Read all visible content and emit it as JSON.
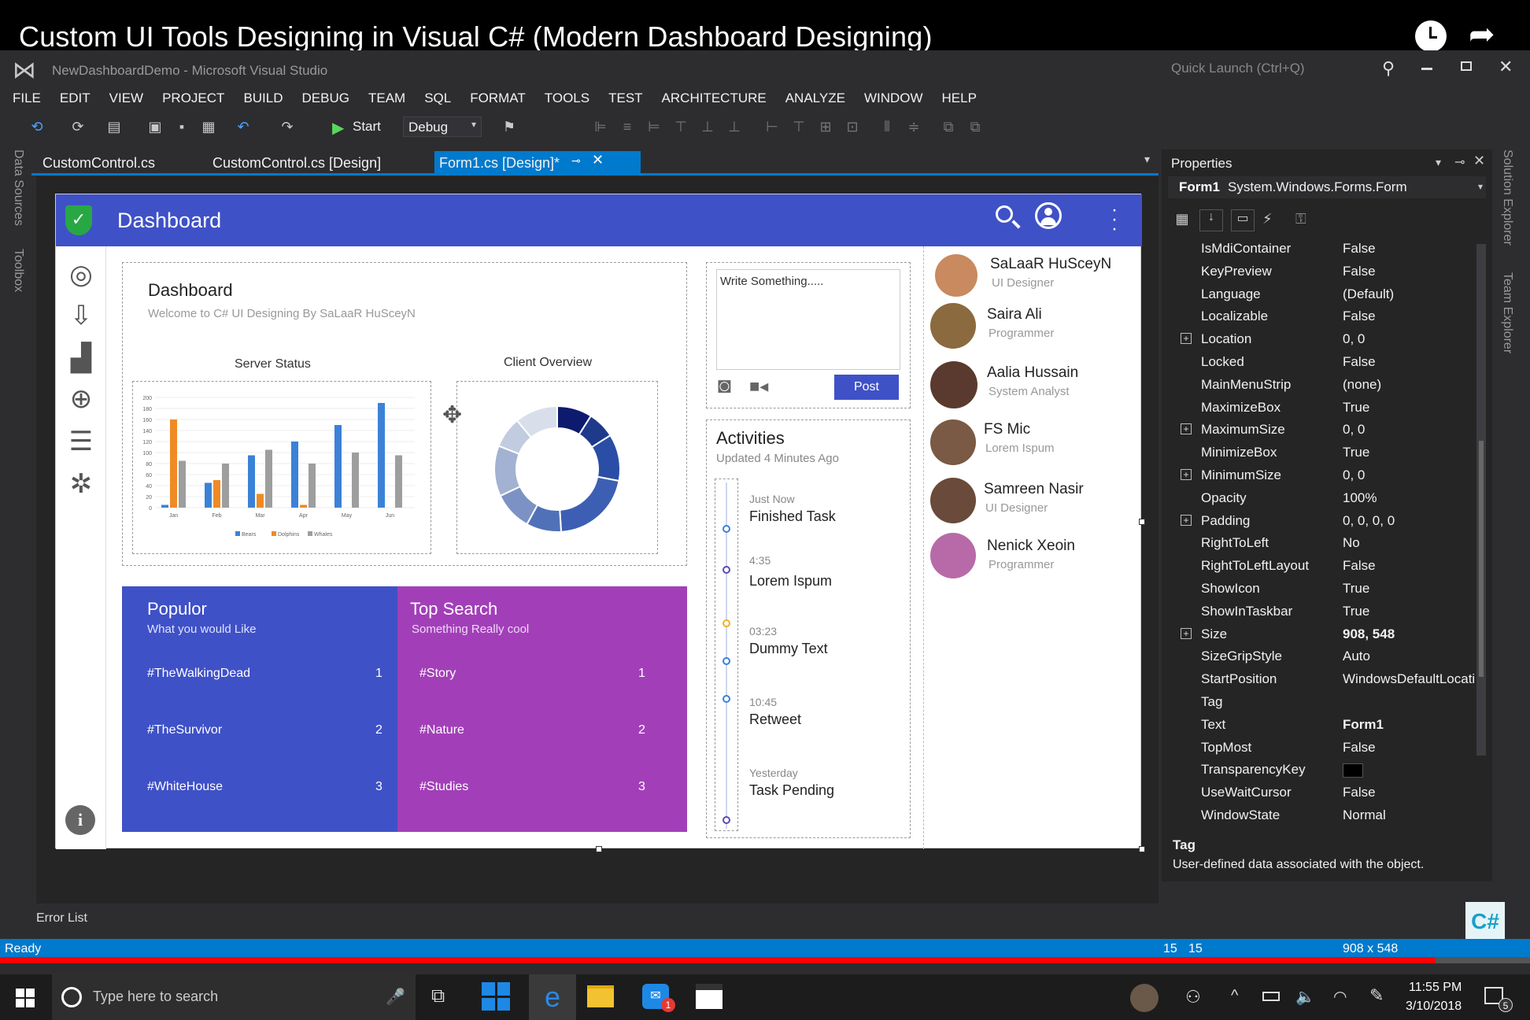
{
  "video_title": "Custom UI Tools Designing in Visual C# (Modern Dashboard Designing)",
  "vs": {
    "window_title": "NewDashboardDemo - Microsoft Visual Studio",
    "quick_launch": "Quick Launch (Ctrl+Q)"
  },
  "menu": [
    "FILE",
    "EDIT",
    "VIEW",
    "PROJECT",
    "BUILD",
    "DEBUG",
    "TEAM",
    "SQL",
    "FORMAT",
    "TOOLS",
    "TEST",
    "ARCHITECTURE",
    "ANALYZE",
    "WINDOW",
    "HELP"
  ],
  "toolbar": {
    "start": "Start",
    "config": "Debug"
  },
  "side_tabs": {
    "data_sources": "Data Sources",
    "toolbox": "Toolbox",
    "solution_explorer": "Solution Explorer",
    "team_explorer": "Team Explorer"
  },
  "tabs": [
    "CustomControl.cs",
    "CustomControl.cs [Design]",
    "Form1.cs [Design]*"
  ],
  "form": {
    "header_title": "Dashboard",
    "main": {
      "title": "Dashboard",
      "subtitle": "Welcome to C# UI Designing By SaLaaR HuSceyN"
    },
    "server_status": "Server Status",
    "client_overview": "Client Overview",
    "post": {
      "placeholder": "Write Something.....",
      "button": "Post"
    },
    "activities": {
      "title": "Activities",
      "updated": "Updated 4 Minutes Ago",
      "items": [
        {
          "time": "Just Now",
          "text": "Finished Task"
        },
        {
          "time": "4:35",
          "text": "Lorem Ispum"
        },
        {
          "time": "03:23",
          "text": "Dummy Text"
        },
        {
          "time": "10:45",
          "text": "Retweet"
        },
        {
          "time": "Yesterday",
          "text": "Task Pending"
        }
      ]
    },
    "popular": {
      "title": "Populor",
      "subtitle": "What you would Like",
      "items": [
        {
          "tag": "#TheWalkingDead",
          "n": "1"
        },
        {
          "tag": "#TheSurvivor",
          "n": "2"
        },
        {
          "tag": "#WhiteHouse",
          "n": "3"
        }
      ]
    },
    "top_search": {
      "title": "Top Search",
      "subtitle": "Something Really cool",
      "items": [
        {
          "tag": "#Story",
          "n": "1"
        },
        {
          "tag": "#Nature",
          "n": "2"
        },
        {
          "tag": "#Studies",
          "n": "3"
        }
      ]
    },
    "people": [
      {
        "name": "SaLaaR HuSceyN",
        "role": "UI Designer",
        "color": "#c88a5e"
      },
      {
        "name": "Saira Ali",
        "role": "Programmer",
        "color": "#8a6a3e"
      },
      {
        "name": "Aalia Hussain",
        "role": "System Analyst",
        "color": "#5a3a2e"
      },
      {
        "name": "FS Mic",
        "role": "Lorem Ispum",
        "color": "#7a5a44"
      },
      {
        "name": "Samreen Nasir",
        "role": "UI Designer",
        "color": "#6a4a3a"
      },
      {
        "name": "Nenick Xeoin",
        "role": "Programmer",
        "color": "#b86aa8"
      }
    ],
    "colors": {
      "header": "#3f51c7",
      "popular": "#3f51c7",
      "top_search": "#a23fb8",
      "post_button": "#3f51c7"
    }
  },
  "properties": {
    "title": "Properties",
    "object": "Form1",
    "object_type": "System.Windows.Forms.Form",
    "rows": [
      {
        "k": "IsMdiContainer",
        "v": "False"
      },
      {
        "k": "KeyPreview",
        "v": "False"
      },
      {
        "k": "Language",
        "v": "(Default)"
      },
      {
        "k": "Localizable",
        "v": "False"
      },
      {
        "k": "Location",
        "v": "0, 0",
        "exp": true
      },
      {
        "k": "Locked",
        "v": "False"
      },
      {
        "k": "MainMenuStrip",
        "v": "(none)"
      },
      {
        "k": "MaximizeBox",
        "v": "True"
      },
      {
        "k": "MaximumSize",
        "v": "0, 0",
        "exp": true
      },
      {
        "k": "MinimizeBox",
        "v": "True"
      },
      {
        "k": "MinimumSize",
        "v": "0, 0",
        "exp": true
      },
      {
        "k": "Opacity",
        "v": "100%"
      },
      {
        "k": "Padding",
        "v": "0, 0, 0, 0",
        "exp": true
      },
      {
        "k": "RightToLeft",
        "v": "No"
      },
      {
        "k": "RightToLeftLayout",
        "v": "False"
      },
      {
        "k": "ShowIcon",
        "v": "True"
      },
      {
        "k": "ShowInTaskbar",
        "v": "True"
      },
      {
        "k": "Size",
        "v": "908, 548",
        "exp": true,
        "bold": true
      },
      {
        "k": "SizeGripStyle",
        "v": "Auto"
      },
      {
        "k": "StartPosition",
        "v": "WindowsDefaultLocati"
      },
      {
        "k": "Tag",
        "v": ""
      },
      {
        "k": "Text",
        "v": "Form1",
        "bold": true
      },
      {
        "k": "TopMost",
        "v": "False"
      },
      {
        "k": "TransparencyKey",
        "v": ""
      },
      {
        "k": "UseWaitCursor",
        "v": "False"
      },
      {
        "k": "WindowState",
        "v": "Normal"
      }
    ],
    "desc_title": "Tag",
    "desc_text": "User-defined data associated with the object."
  },
  "error_list": "Error List",
  "status": {
    "ready": "Ready",
    "pos1": "15",
    "pos2": "15",
    "size": "908 x 548"
  },
  "taskbar": {
    "search": "Type here to search",
    "time": "11:55 PM",
    "date": "3/10/2018",
    "notif": "5",
    "msg_badge": "1"
  },
  "chart_data": [
    {
      "type": "bar",
      "title": "Server Status",
      "categories": [
        "Jan",
        "Feb",
        "Mar",
        "Apr",
        "May",
        "Jun"
      ],
      "ylim": [
        0,
        200
      ],
      "series": [
        {
          "name": "Bears",
          "color": "#3b82d6",
          "values": [
            5,
            45,
            95,
            120,
            150,
            190
          ]
        },
        {
          "name": "Dolphins",
          "color": "#f08a24",
          "values": [
            160,
            50,
            25,
            5,
            0,
            0
          ]
        },
        {
          "name": "Whales",
          "color": "#9e9e9e",
          "values": [
            85,
            80,
            105,
            80,
            100,
            95
          ]
        }
      ]
    },
    {
      "type": "pie",
      "title": "Client Overview",
      "values": [
        9,
        7,
        12,
        21,
        9,
        10,
        13,
        8,
        11
      ],
      "colors": [
        "#0d1b6e",
        "#1e3a8a",
        "#2a4da6",
        "#3d5fb3",
        "#5071b8",
        "#7d92c4",
        "#a3b2d2",
        "#c1cce0",
        "#d8dfea"
      ]
    }
  ]
}
